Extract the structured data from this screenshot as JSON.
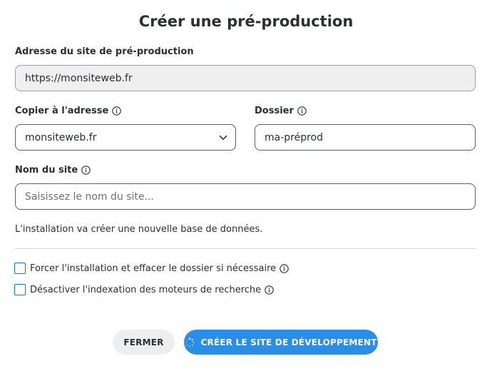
{
  "dialog": {
    "title": "Créer une pré-production",
    "address": {
      "label": "Adresse du site de pré-production",
      "value": "https://monsiteweb.fr"
    },
    "copy_to": {
      "label": "Copier à l'adresse",
      "selected": "monsiteweb.fr"
    },
    "folder": {
      "label": "Dossier",
      "value": "ma-préprod"
    },
    "site_name": {
      "label": "Nom du site",
      "placeholder": "Saisissez le nom du site..."
    },
    "note": "L'installation va créer une nouvelle base de données.",
    "options": [
      {
        "label": "Forcer l'installation et effacer le dossier si nécessaire",
        "checked": false
      },
      {
        "label": "Désactiver l'indexation des moteurs de recherche",
        "checked": false
      }
    ],
    "buttons": {
      "close": "FERMER",
      "create": "CRÉER LE SITE DE DÉVELOPPEMENT"
    }
  },
  "colors": {
    "accent": "#2a8ee6",
    "checkbox_border": "#1a6fd1",
    "text": "#2b2f33",
    "readonly_bg": "#efefef"
  },
  "icons": [
    "info-icon",
    "chevron-down-icon",
    "spinner-icon"
  ]
}
